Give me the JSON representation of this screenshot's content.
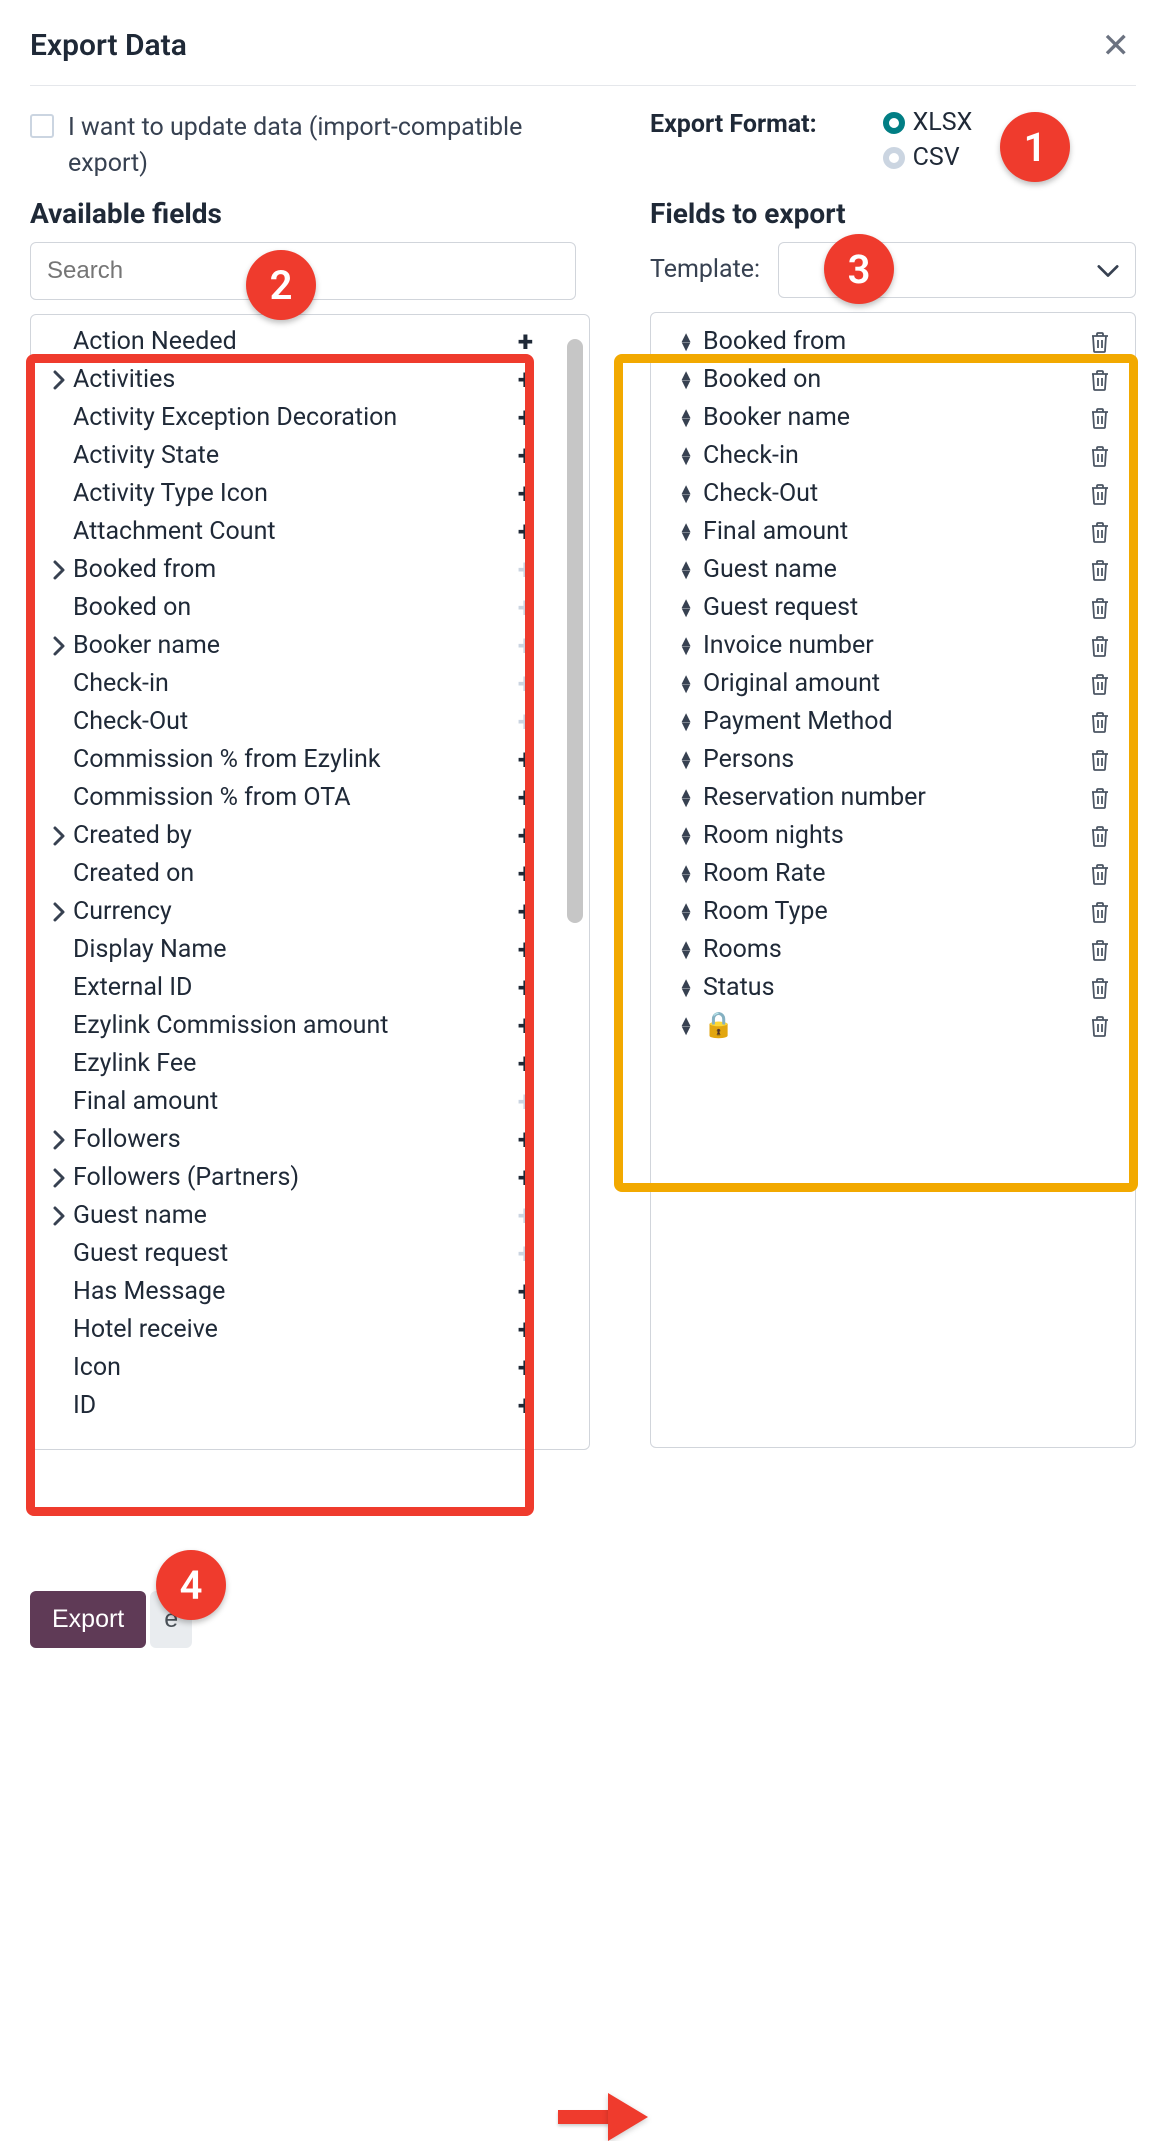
{
  "dialog": {
    "title": "Export Data"
  },
  "update_checkbox": {
    "label": "I want to update data (import-compatible export)",
    "checked": false
  },
  "export_format": {
    "label": "Export Format:",
    "options": [
      {
        "value": "XLSX",
        "checked": true
      },
      {
        "value": "CSV",
        "checked": false
      }
    ]
  },
  "available": {
    "title": "Available fields",
    "search_placeholder": "Search",
    "items": [
      {
        "label": "Action Needed",
        "expandable": false,
        "added": false
      },
      {
        "label": "Activities",
        "expandable": true,
        "added": false
      },
      {
        "label": "Activity Exception Decoration",
        "expandable": false,
        "added": false
      },
      {
        "label": "Activity State",
        "expandable": false,
        "added": false
      },
      {
        "label": "Activity Type Icon",
        "expandable": false,
        "added": false
      },
      {
        "label": "Attachment Count",
        "expandable": false,
        "added": false
      },
      {
        "label": "Booked from",
        "expandable": true,
        "added": true
      },
      {
        "label": "Booked on",
        "expandable": false,
        "added": true
      },
      {
        "label": "Booker name",
        "expandable": true,
        "added": true
      },
      {
        "label": "Check-in",
        "expandable": false,
        "added": true
      },
      {
        "label": "Check-Out",
        "expandable": false,
        "added": true
      },
      {
        "label": "Commission % from Ezylink",
        "expandable": false,
        "added": false
      },
      {
        "label": "Commission % from OTA",
        "expandable": false,
        "added": false
      },
      {
        "label": "Created by",
        "expandable": true,
        "added": false
      },
      {
        "label": "Created on",
        "expandable": false,
        "added": false
      },
      {
        "label": "Currency",
        "expandable": true,
        "added": false
      },
      {
        "label": "Display Name",
        "expandable": false,
        "added": false
      },
      {
        "label": "External ID",
        "expandable": false,
        "added": false
      },
      {
        "label": "Ezylink Commission amount",
        "expandable": false,
        "added": false
      },
      {
        "label": "Ezylink Fee",
        "expandable": false,
        "added": false
      },
      {
        "label": "Final amount",
        "expandable": false,
        "added": true
      },
      {
        "label": "Followers",
        "expandable": true,
        "added": false
      },
      {
        "label": "Followers (Partners)",
        "expandable": true,
        "added": false
      },
      {
        "label": "Guest name",
        "expandable": true,
        "added": true
      },
      {
        "label": "Guest request",
        "expandable": false,
        "added": true
      },
      {
        "label": "Has Message",
        "expandable": false,
        "added": false
      },
      {
        "label": "Hotel receive",
        "expandable": false,
        "added": false
      },
      {
        "label": "Icon",
        "expandable": false,
        "added": false
      },
      {
        "label": "ID",
        "expandable": false,
        "added": false
      }
    ]
  },
  "export_fields": {
    "title": "Fields to export",
    "template_label": "Template:",
    "items": [
      {
        "label": "Booked from"
      },
      {
        "label": "Booked on"
      },
      {
        "label": "Booker name"
      },
      {
        "label": "Check-in"
      },
      {
        "label": "Check-Out"
      },
      {
        "label": "Final amount"
      },
      {
        "label": "Guest name"
      },
      {
        "label": "Guest request"
      },
      {
        "label": "Invoice number"
      },
      {
        "label": "Original amount"
      },
      {
        "label": "Payment Method"
      },
      {
        "label": "Persons"
      },
      {
        "label": "Reservation number"
      },
      {
        "label": "Room nights"
      },
      {
        "label": "Room Rate"
      },
      {
        "label": "Room Type"
      },
      {
        "label": "Rooms"
      },
      {
        "label": "Status"
      },
      {
        "label": "🔒"
      }
    ]
  },
  "footer": {
    "export_label": "Export",
    "close_fragment": "e"
  },
  "badges": {
    "b1": "1",
    "b2": "2",
    "b3": "3",
    "b4": "4"
  }
}
